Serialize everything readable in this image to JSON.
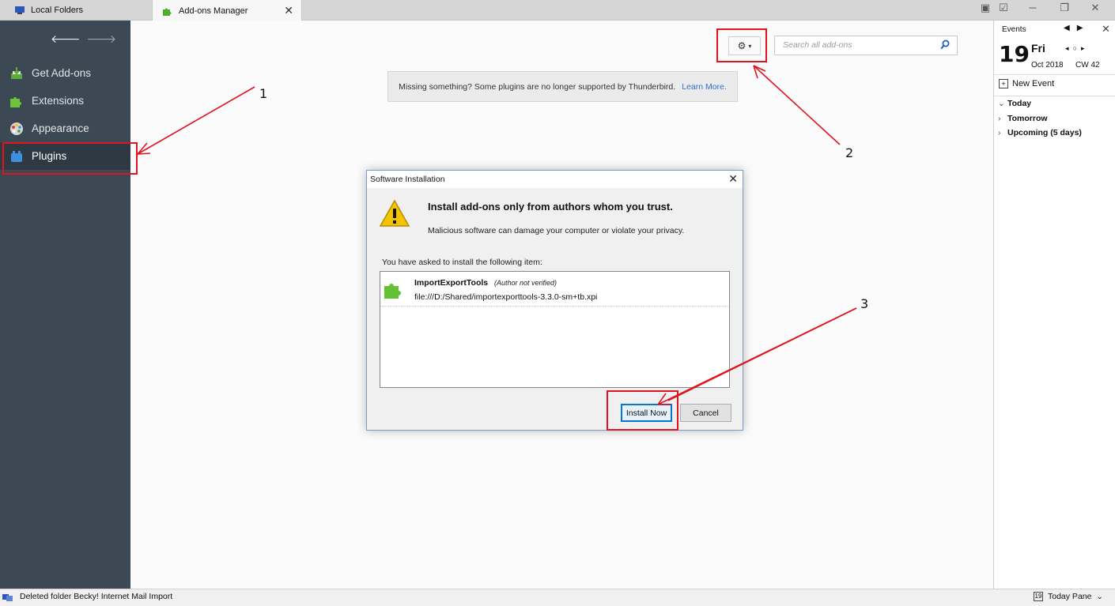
{
  "tabs": {
    "local_folders": "Local Folders",
    "addons_manager": "Add-ons Manager"
  },
  "sidebar": {
    "categories": [
      {
        "label": "Get Add-ons",
        "icon": "get-addons-icon"
      },
      {
        "label": "Extensions",
        "icon": "puzzle-icon"
      },
      {
        "label": "Appearance",
        "icon": "palette-icon"
      },
      {
        "label": "Plugins",
        "icon": "plugin-icon",
        "selected": true
      }
    ]
  },
  "main": {
    "search_placeholder": "Search all add-ons",
    "notice_text": "Missing something? Some plugins are no longer supported by Thunderbird.",
    "notice_link": "Learn More."
  },
  "dialog": {
    "title": "Software Installation",
    "heading": "Install add-ons only from authors whom you trust.",
    "subtext": "Malicious software can damage your computer or violate your privacy.",
    "asked": "You have asked to install the following item:",
    "item_name": "ImportExportTools",
    "item_author": "(Author not verified)",
    "item_url": "file:///D:/Shared/importexporttools-3.3.0-sm+tb.xpi",
    "install_label": "Install Now",
    "cancel_label": "Cancel"
  },
  "today_pane": {
    "events_label": "Events",
    "day_number": "19",
    "day_name": "Fri",
    "month_year": "Oct 2018",
    "calendar_week": "CW 42",
    "new_event": "New Event",
    "groups": [
      "Today",
      "Tomorrow",
      "Upcoming (5 days)"
    ]
  },
  "status": {
    "text": "Deleted folder Becky! Internet Mail Import",
    "today_pane_button": "Today Pane"
  },
  "annotations": [
    "1",
    "2",
    "3"
  ],
  "colors": {
    "sidebar_bg": "#3c4854",
    "annotation_red": "#e0141e",
    "link_blue": "#2f6fd1",
    "accent_blue": "#0078d7"
  }
}
